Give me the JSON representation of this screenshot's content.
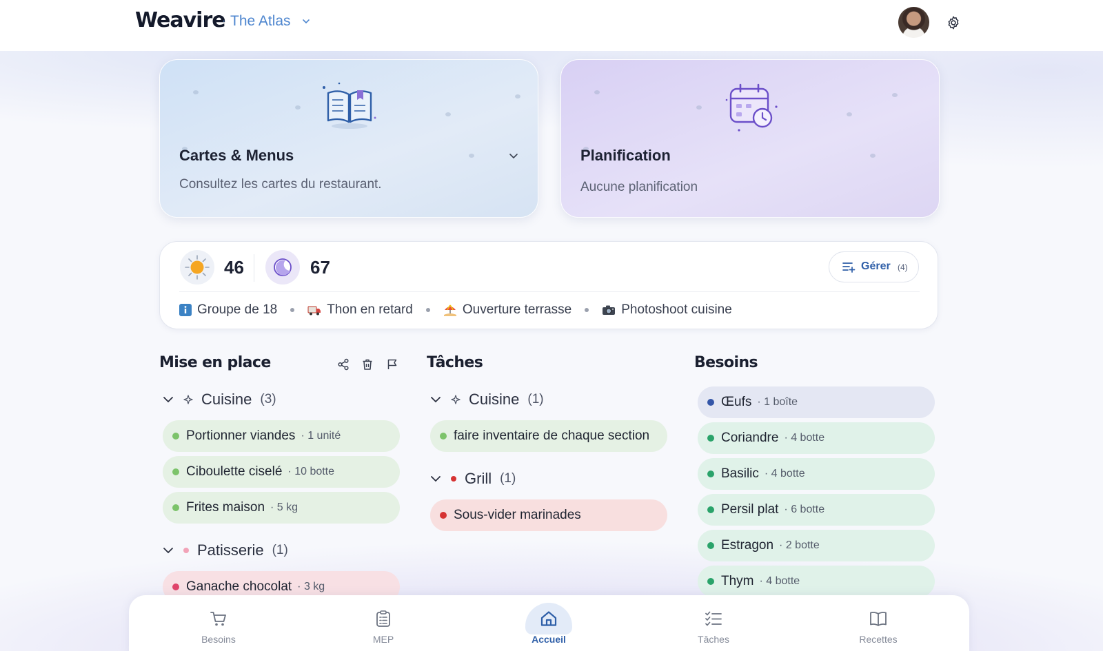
{
  "header": {
    "brand": "Weavire",
    "separator": "·",
    "workspace": "The Atlas"
  },
  "cards": {
    "menus": {
      "title": "Cartes & Menus",
      "subtitle": "Consultez les cartes du restaurant."
    },
    "planning": {
      "title": "Planification",
      "subtitle": "Aucune planification"
    }
  },
  "covers": {
    "lunch": "46",
    "dinner": "67"
  },
  "manage": {
    "label": "Gérer",
    "count": "(4)"
  },
  "alerts": [
    {
      "label": "Groupe de 18",
      "icon": "info-icon"
    },
    {
      "label": "Thon en retard",
      "icon": "delivery-truck-icon"
    },
    {
      "label": "Ouverture terrasse",
      "icon": "beach-umbrella-icon"
    },
    {
      "label": "Photoshoot cuisine",
      "icon": "camera-icon"
    }
  ],
  "mise_en_place": {
    "title": "Mise en place",
    "groups": [
      {
        "name": "Cuisine",
        "count": "(3)",
        "items": [
          {
            "name": "Portionner viandes",
            "qty": "· 1 unité"
          },
          {
            "name": "Ciboulette ciselé",
            "qty": "· 10 botte"
          },
          {
            "name": "Frites maison",
            "qty": "· 5 kg"
          }
        ]
      },
      {
        "name": "Patisserie",
        "count": "(1)",
        "items": [
          {
            "name": "Ganache chocolat",
            "qty": "· 3 kg"
          }
        ]
      }
    ]
  },
  "taches": {
    "title": "Tâches",
    "groups": [
      {
        "name": "Cuisine",
        "count": "(1)",
        "items": [
          {
            "name": "faire inventaire de chaque section"
          }
        ]
      },
      {
        "name": "Grill",
        "count": "(1)",
        "items": [
          {
            "name": "Sous-vider marinades"
          }
        ]
      }
    ]
  },
  "besoins": {
    "title": "Besoins",
    "items": [
      {
        "name": "Œufs",
        "qty": "· 1 boîte"
      },
      {
        "name": "Coriandre",
        "qty": "· 4 botte"
      },
      {
        "name": "Basilic",
        "qty": "· 4 botte"
      },
      {
        "name": "Persil plat",
        "qty": "· 6 botte"
      },
      {
        "name": "Estragon",
        "qty": "· 2 botte"
      },
      {
        "name": "Thym",
        "qty": "· 4 botte"
      }
    ]
  },
  "nav": [
    {
      "label": "Besoins",
      "icon": "cart-icon"
    },
    {
      "label": "MEP",
      "icon": "clipboard-icon"
    },
    {
      "label": "Accueil",
      "icon": "home-icon"
    },
    {
      "label": "Tâches",
      "icon": "checklist-icon"
    },
    {
      "label": "Recettes",
      "icon": "book-icon"
    }
  ],
  "colors": {
    "accent": "#2f5fa8",
    "brand_link": "#4e86cf",
    "mep_dot": "#7cc36a",
    "grill_dot": "#d63333",
    "patisserie_dot": "#e0446a",
    "besoin_dot": "#2aa36a"
  }
}
